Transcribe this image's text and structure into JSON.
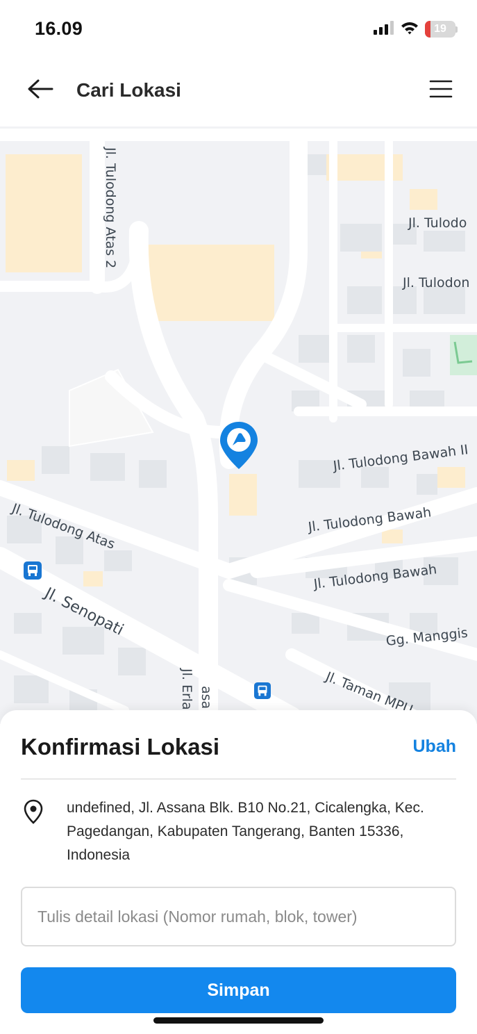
{
  "status_bar": {
    "time": "16.09",
    "battery_level": "19",
    "battery_fraction": 0.19,
    "icons": [
      "cellular-signal-icon",
      "wifi-icon",
      "battery-icon"
    ]
  },
  "header": {
    "title": "Cari Lokasi",
    "icons": [
      "back-arrow-icon",
      "hamburger-menu-icon"
    ]
  },
  "map": {
    "street_labels": {
      "tulodong_atas_2": "Jl. Tulodong Atas 2",
      "tulodong_1": "Jl. Tulodo",
      "tulodong_2": "Jl. Tulodon",
      "tulodong_bawah_ii": "Jl. Tulodong Bawah II",
      "tulodong_bawah_1": "Jl. Tulodong Bawah",
      "tulodong_bawah_2": "Jl. Tulodong Bawah",
      "tulodong_atas": "Jl. Tulodong Atas",
      "senopati": "Jl. Senopati",
      "gg_manggis": "Gg. Manggis",
      "erla": "Jl. Erla",
      "asa": "asa",
      "taman_mpu": "Jl. Taman MPU"
    },
    "icons": [
      "bus-stop-icon",
      "location-pin-icon"
    ],
    "colors": {
      "pin": "#1482e0",
      "park": "#c8ebd2",
      "building": "#fde9c4"
    }
  },
  "sheet": {
    "title": "Konfirmasi Lokasi",
    "change_label": "Ubah",
    "address": "undefined, Jl. Assana Blk. B10 No.21, Cicalengka, Kec. Pagedangan, Kabupaten Tangerang, Banten 15336, Indonesia",
    "detail_placeholder": "Tulis detail lokasi (Nomor rumah, blok, tower)",
    "detail_value": "",
    "save_label": "Simpan",
    "icons": [
      "map-pin-outline-icon"
    ],
    "colors": {
      "accent": "#1388ee"
    }
  }
}
